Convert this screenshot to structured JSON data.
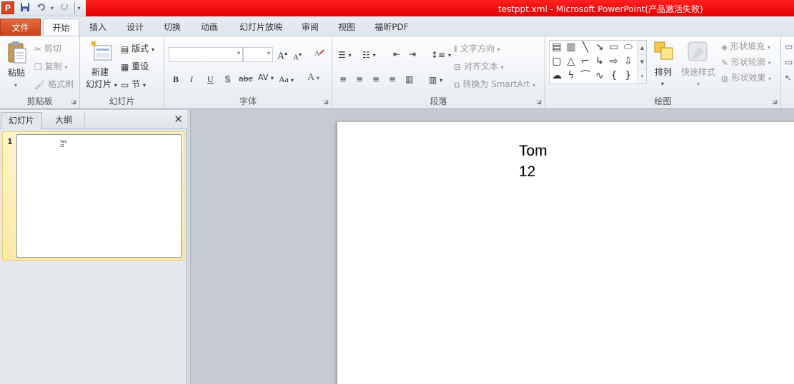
{
  "window": {
    "title": "testppt.xml  -  Microsoft PowerPoint(产品激活失败)",
    "app_icon_letter": "P"
  },
  "ribbon_tabs": [
    "文件",
    "开始",
    "插入",
    "设计",
    "切换",
    "动画",
    "幻灯片放映",
    "审阅",
    "视图",
    "福昕PDF"
  ],
  "clipboard": {
    "label": "剪贴板",
    "paste": "粘贴",
    "cut": "剪切",
    "copy": "复制",
    "format_painter": "格式刷"
  },
  "slides_group": {
    "label": "幻灯片",
    "new_slide_line1": "新建",
    "new_slide_line2": "幻灯片",
    "layout": "版式",
    "reset": "重设",
    "section": "节"
  },
  "font_group": {
    "label": "字体",
    "bold": "B",
    "italic": "I",
    "underline": "U",
    "shadow": "S",
    "strikethrough": "abc",
    "spacing": "AV",
    "case": "Aa",
    "color": "A",
    "grow": "A",
    "shrink": "A"
  },
  "paragraph_group": {
    "label": "段落",
    "text_direction": "文字方向",
    "align_text": "对齐文本",
    "convert_smartart": "转换为 SmartArt"
  },
  "drawing_group": {
    "label": "绘图",
    "arrange": "排列",
    "quick_styles": "快速样式",
    "shape_fill": "形状填充",
    "shape_outline": "形状轮廓",
    "shape_effects": "形状效果"
  },
  "left_panel": {
    "tab_slides": "幻灯片",
    "tab_outline": "大纲",
    "close": "✕",
    "slide_number": "1"
  },
  "slide": {
    "lines": [
      "Tom",
      "12"
    ]
  },
  "colors": {
    "title_bar_red": "#e60000",
    "file_tab": "#d24e24",
    "selected_slide": "#fde9a6"
  }
}
